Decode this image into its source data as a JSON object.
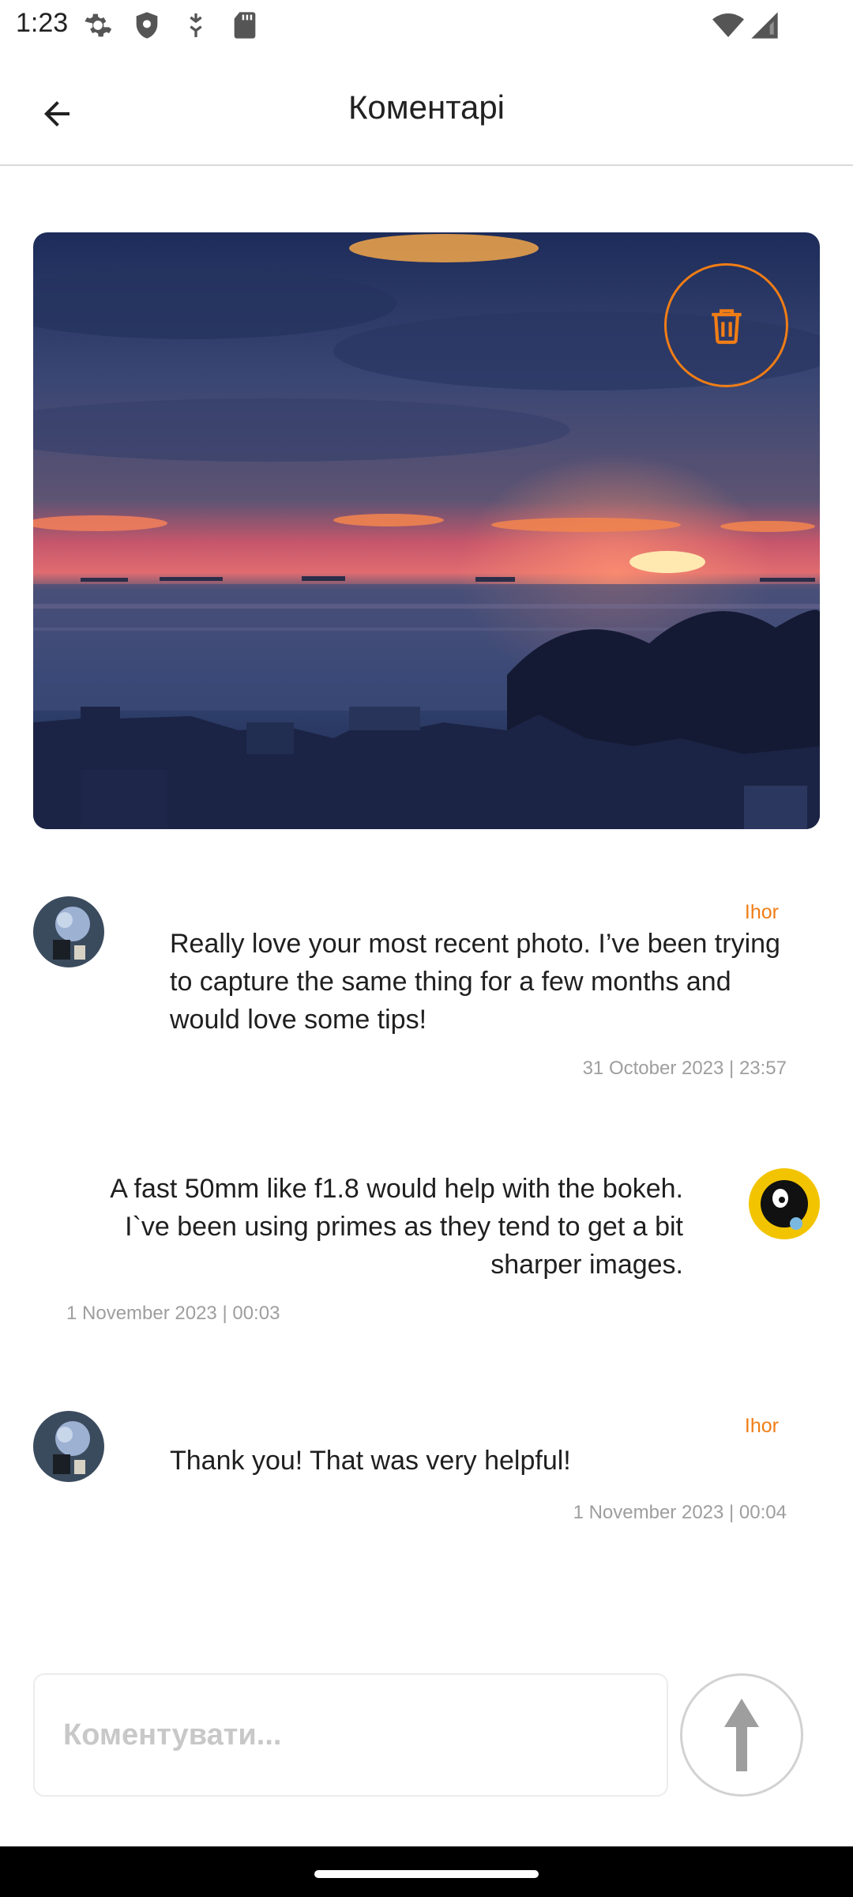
{
  "status_bar": {
    "time": "1:23",
    "icons": [
      "settings-icon",
      "shield-icon",
      "data-saver-icon",
      "sd-card-icon",
      "wifi-icon",
      "cell-signal-icon"
    ]
  },
  "app_bar": {
    "title": "Коментарі",
    "back_icon": "arrow-back-icon"
  },
  "post": {
    "delete_icon": "trash-icon",
    "accent_color": "#f07d16"
  },
  "comments": [
    {
      "author": "Ihor",
      "text": "Really love your most recent photo. I’ve been trying to capture the same thing for a few months and would love some tips!",
      "date": "31 October 2023 | 23:57"
    },
    {
      "author": "",
      "text": "A fast 50mm like f1.8 would help with the bokeh. I`ve been using primes as they tend to get a bit sharper images.",
      "date": "1 November 2023 | 00:03"
    },
    {
      "author": "Ihor",
      "text": "Thank you! That was very helpful!",
      "date": "1 November 2023 | 00:04"
    }
  ],
  "composer": {
    "placeholder": "Коментувати...",
    "value": "",
    "send_icon": "arrow-up-icon"
  }
}
